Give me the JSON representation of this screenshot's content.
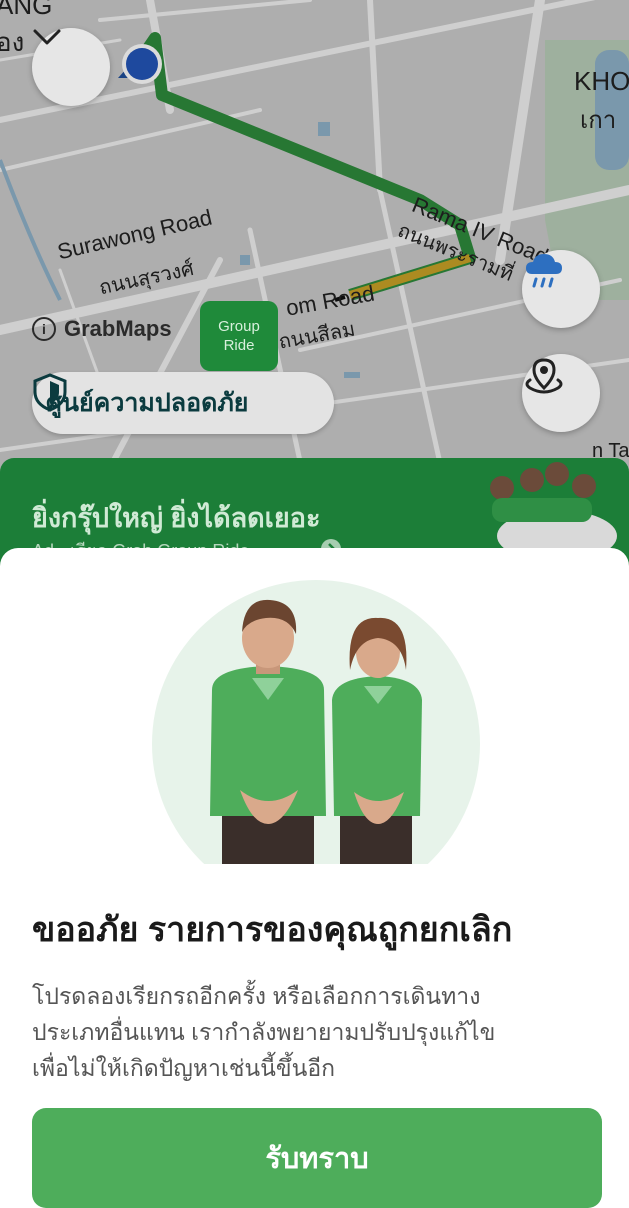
{
  "map": {
    "labels": {
      "road_surawong_en": "Surawong Road",
      "road_surawong_th": "ถนนสุรวงศ์",
      "road_rama4_en": "Rama IV Road",
      "road_rama4_th": "ถนนพระรามที่",
      "road_silom_en": "om Road",
      "road_silom_th": "ถนนสีลม",
      "area_khon_en": "KHO",
      "area_khon_th": "เกา",
      "top_left_en": "ANG",
      "top_left_th": "อง",
      "bottom_right": "n Ta"
    },
    "attribution": "GrabMaps",
    "group_ride_marker": {
      "line1": "Group",
      "line2": "Ride"
    },
    "safety_center_label": "ศูนย์ความปลอดภัย",
    "route_color": "#2e8b3c",
    "traffic_color": "#c9a227"
  },
  "promo": {
    "title": "ยิ่งกรุ๊ปใหญ่ ยิ่งได้ลดเยอะ",
    "subtitle": "Ad · เรียก Grab Group Ride"
  },
  "dialog": {
    "title": "ขออภัย รายการของคุณถูกยกเลิก",
    "body": "โปรดลองเรียกรถอีกครั้ง หรือเลือกการเดินทาง\nประเภทอื่นแทน เรากำลังพยายามปรับปรุงแก้ไข\nเพื่อไม่ให้เกิดปัญหาเช่นนี้ขึ้นอีก",
    "button_label": "รับทราบ",
    "accent_color": "#4ead5b"
  },
  "icons": [
    "chevron-down-icon",
    "user-location-icon",
    "weather-rain-icon",
    "recenter-location-icon",
    "shield-icon",
    "info-icon",
    "chevron-right-icon"
  ]
}
